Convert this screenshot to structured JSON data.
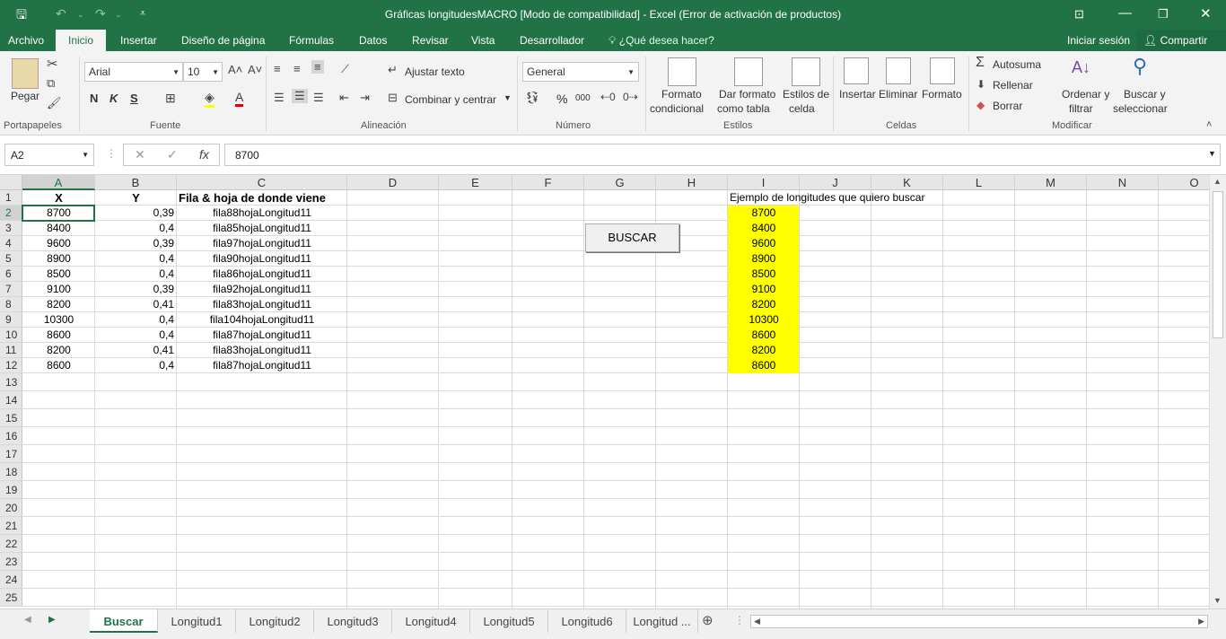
{
  "window": {
    "title": "Gráficas longitudesMACRO  [Modo de compatibilidad] - Excel (Error de activación de productos)"
  },
  "menu": {
    "tabs": [
      "Archivo",
      "Inicio",
      "Insertar",
      "Diseño de página",
      "Fórmulas",
      "Datos",
      "Revisar",
      "Vista",
      "Desarrollador"
    ],
    "active_tab": "Inicio",
    "help": "¿Qué desea hacer?",
    "signin": "Iniciar sesión",
    "share": "Compartir"
  },
  "ribbon": {
    "paste": "Pegar",
    "font_name": "Arial",
    "font_size": "10",
    "bold": "N",
    "italic": "K",
    "underline": "S",
    "wrap": "Ajustar texto",
    "merge": "Combinar y centrar",
    "number_format": "General",
    "percent": "%",
    "thousands": "000",
    "cond_format_1": "Formato",
    "cond_format_2": "condicional",
    "table_format_1": "Dar formato",
    "table_format_2": "como tabla",
    "cell_styles_1": "Estilos de",
    "cell_styles_2": "celda",
    "insert": "Insertar",
    "delete": "Eliminar",
    "format": "Formato",
    "autosum": "Autosuma",
    "fill": "Rellenar",
    "clear": "Borrar",
    "sort_1": "Ordenar y",
    "sort_2": "filtrar",
    "find_1": "Buscar y",
    "find_2": "seleccionar",
    "groups": [
      "Portapapeles",
      "Fuente",
      "Alineación",
      "Número",
      "Estilos",
      "Celdas",
      "Modificar"
    ]
  },
  "formula_bar": {
    "name_box": "A2",
    "value": "8700",
    "fx": "fx"
  },
  "sheet": {
    "columns": [
      "A",
      "B",
      "C",
      "D",
      "E",
      "F",
      "G",
      "H",
      "I",
      "J",
      "K",
      "L",
      "M",
      "N",
      "O"
    ],
    "rows": [
      "1",
      "2",
      "3",
      "4",
      "5",
      "6",
      "7",
      "8",
      "9",
      "10",
      "11",
      "12",
      "13",
      "14",
      "15",
      "16",
      "17",
      "18",
      "19",
      "20",
      "21",
      "22",
      "23",
      "24",
      "25"
    ],
    "headers": {
      "A": "X",
      "B": "Y",
      "C": "Fila & hoja de donde viene",
      "I": "Ejemplo de longitudes que quiero buscar"
    },
    "col_a": [
      "8700",
      "8400",
      "9600",
      "8900",
      "8500",
      "9100",
      "8200",
      "10300",
      "8600",
      "8200",
      "8600"
    ],
    "col_b": [
      "0,39",
      "0,4",
      "0,39",
      "0,4",
      "0,4",
      "0,39",
      "0,41",
      "0,4",
      "0,4",
      "0,41",
      "0,4"
    ],
    "col_c": [
      "fila88hojaLongitud11",
      "fila85hojaLongitud11",
      "fila97hojaLongitud11",
      "fila90hojaLongitud11",
      "fila86hojaLongitud11",
      "fila92hojaLongitud11",
      "fila83hojaLongitud11",
      "fila104hojaLongitud11",
      "fila87hojaLongitud11",
      "fila83hojaLongitud11",
      "fila87hojaLongitud11"
    ],
    "col_i": [
      "8700",
      "8400",
      "9600",
      "8900",
      "8500",
      "9100",
      "8200",
      "10300",
      "8600",
      "8200",
      "8600"
    ],
    "highlight_color": "#ffff00",
    "button_label": "BUSCAR"
  },
  "sheet_tabs": [
    "Buscar",
    "Longitud1",
    "Longitud2",
    "Longitud3",
    "Longitud4",
    "Longitud5",
    "Longitud6",
    "Longitud ..."
  ],
  "active_sheet": "Buscar",
  "colors": {
    "accent": "#217346"
  }
}
